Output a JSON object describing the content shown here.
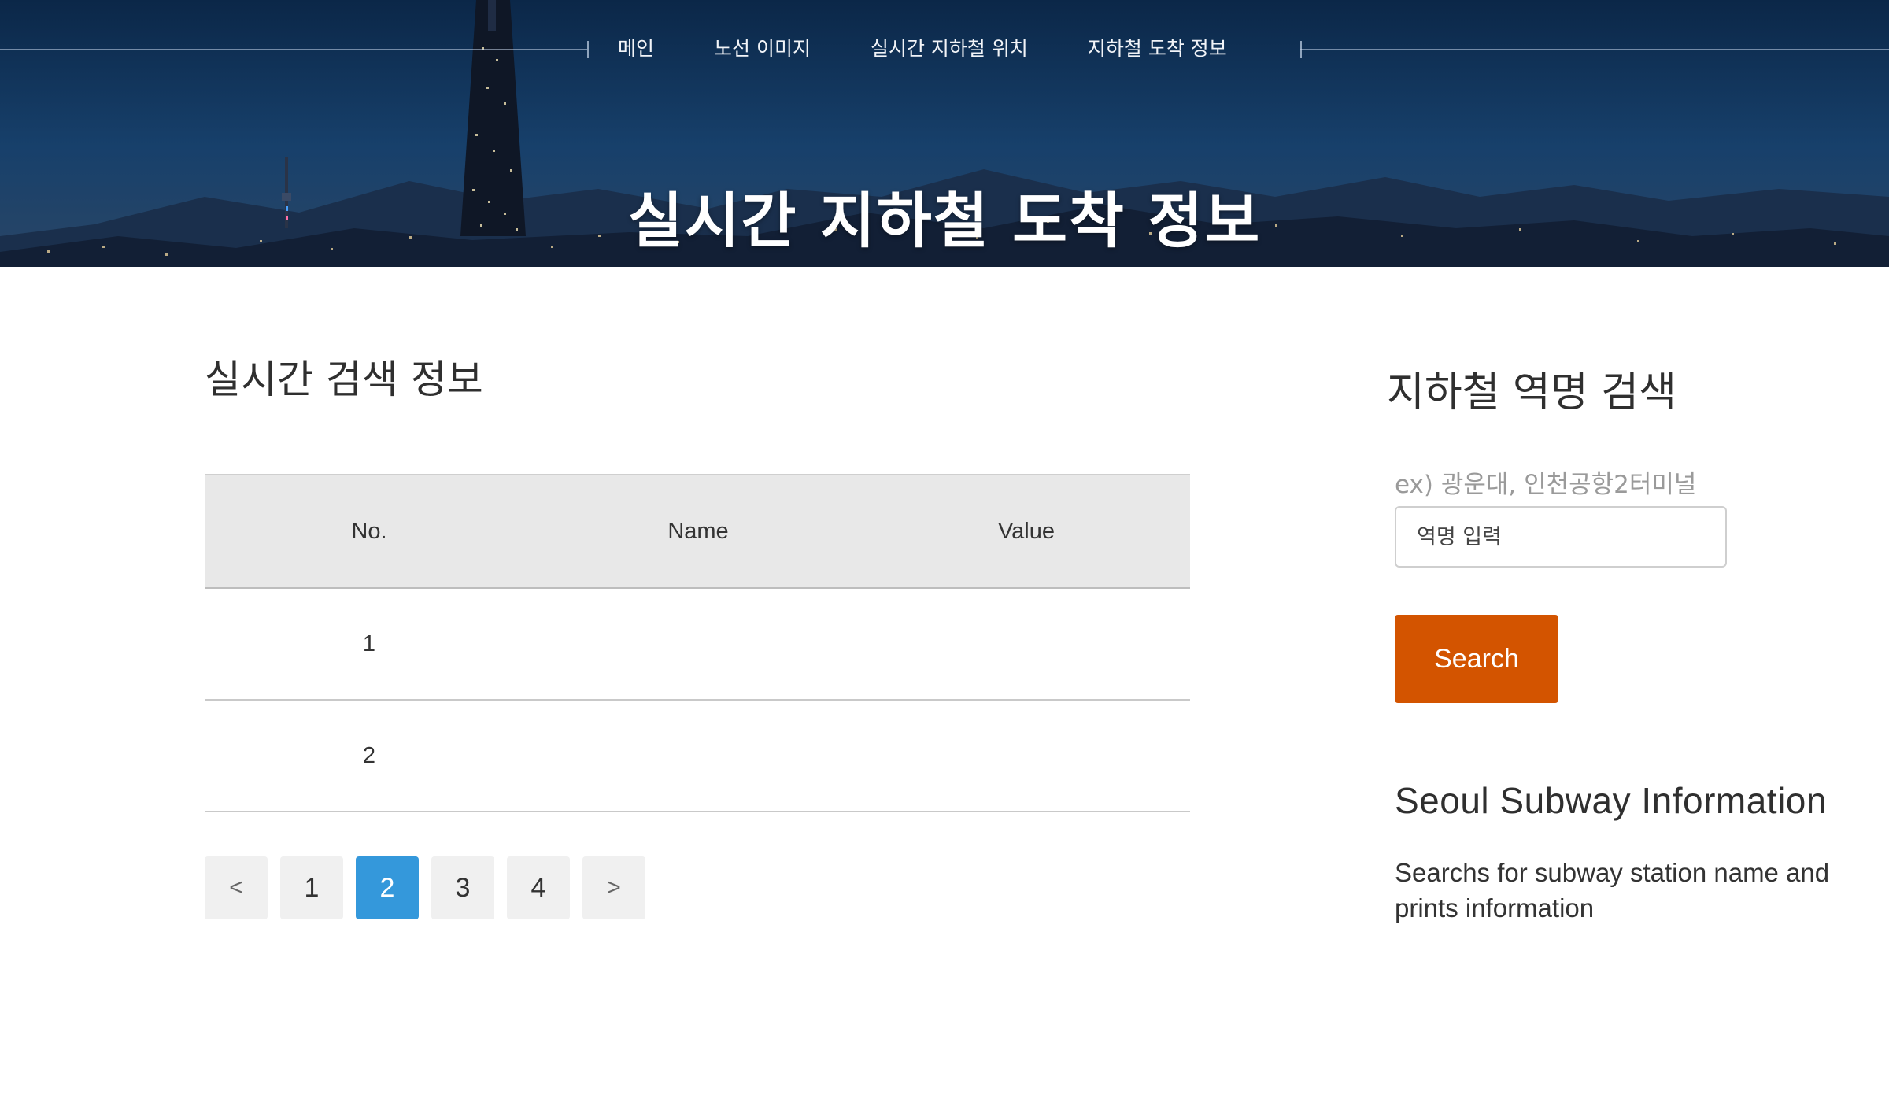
{
  "nav": {
    "items": [
      {
        "label": "메인"
      },
      {
        "label": "노선 이미지"
      },
      {
        "label": "실시간 지하철 위치"
      },
      {
        "label": "지하철 도착 정보"
      }
    ]
  },
  "hero": {
    "title": "실시간 지하철 도착 정보"
  },
  "main": {
    "section_title": "실시간 검색 정보",
    "table": {
      "headers": [
        "No.",
        "Name",
        "Value"
      ],
      "rows": [
        {
          "no": "1",
          "name": "",
          "value": ""
        },
        {
          "no": "2",
          "name": "",
          "value": ""
        }
      ]
    },
    "pagination": {
      "prev": "<",
      "pages": [
        "1",
        "2",
        "3",
        "4"
      ],
      "active_page": "2",
      "next": ">"
    }
  },
  "sidebar": {
    "title": "지하철 역명 검색",
    "hint": "ex) 광운대, 인천공항2터미널",
    "input_placeholder": "역명 입력",
    "search_label": "Search",
    "info_title": "Seoul Subway Information",
    "info_text": "Searchs for subway station name and prints information"
  },
  "colors": {
    "accent_button": "#d35400",
    "active_page": "#3498db",
    "hero_sky": "#12355d"
  }
}
